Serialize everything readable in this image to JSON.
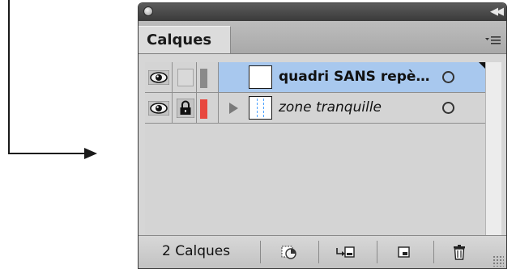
{
  "panel": {
    "tab_label": "Calques",
    "layer_count_label": "2 Calques"
  },
  "layers": [
    {
      "name": "quadri SANS repè…",
      "selected": true,
      "visible": true,
      "locked": false,
      "color": "#8a8a8a",
      "style": "bold",
      "icons": [
        "eye-icon",
        "lock-slot",
        "target-circle-icon"
      ]
    },
    {
      "name": "zone tranquille",
      "selected": false,
      "visible": true,
      "locked": true,
      "color": "#e8473e",
      "style": "italic",
      "icons": [
        "eye-icon",
        "lock-icon",
        "expand-arrow-icon",
        "target-circle-icon"
      ]
    }
  ],
  "bottom_buttons": [
    {
      "icon": "locate-object-icon"
    },
    {
      "icon": "make-clipping-mask-icon"
    },
    {
      "icon": "new-layer-icon"
    },
    {
      "icon": "trash-icon"
    }
  ],
  "colors": {
    "selected_row": "#a8c8ee",
    "panel_bg": "#d6d6d6",
    "titlebar": "#4a4a4a"
  }
}
